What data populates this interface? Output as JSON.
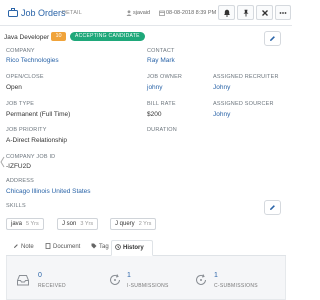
{
  "header": {
    "title": "Job Orders",
    "subtitle": "DETAIL",
    "user": "sjavaid",
    "date": "08-08-2018 8:39 PM",
    "buttons": [
      "bell-icon",
      "pin-icon",
      "close-icon",
      "more-icon"
    ]
  },
  "job": {
    "position_title": "Java Developer",
    "openings_count": "10",
    "status": "ACCEPTING CANDIDATE"
  },
  "details": {
    "company_label": "COMPANY",
    "company": "Rico Technologies",
    "contact_label": "CONTACT",
    "contact": "Ray Mark",
    "open_close_label": "OPEN/CLOSE",
    "open_close": "Open",
    "job_owner_label": "JOB OWNER",
    "job_owner": "johny",
    "assigned_recruiter_label": "ASSIGNED RECRUITER",
    "assigned_recruiter": "Johny",
    "job_type_label": "JOB TYPE",
    "job_type": "Permanent (Full Time)",
    "bill_rate_label": "BILL RATE",
    "bill_rate": "$200",
    "assigned_sourcer_label": "ASSIGNED SOURCER",
    "assigned_sourcer": "Johny",
    "job_priority_label": "JOB PRIORITY",
    "job_priority": "A-Direct Relationship",
    "duration_label": "DURATION",
    "company_job_id_label": "COMPANY JOB ID",
    "company_job_id": "-IZFU2D",
    "address_label": "ADDRESS",
    "address": "Chicago Illinois United States",
    "skills_label": "SKILLS"
  },
  "skills": [
    {
      "name": "java",
      "years": "5 Yrs"
    },
    {
      "name": "J son",
      "years": "3 Yrs"
    },
    {
      "name": "J query",
      "years": "2 Yrs"
    }
  ],
  "tabs": [
    {
      "label": "Note",
      "icon": "note-icon"
    },
    {
      "label": "Document",
      "icon": "document-icon"
    },
    {
      "label": "Tag",
      "icon": "tag-icon"
    },
    {
      "label": "History",
      "icon": "history-icon",
      "active": true
    }
  ],
  "stats": [
    {
      "value": "0",
      "label": "RECEIVED",
      "icon": "inbox-icon"
    },
    {
      "value": "1",
      "label": "I-SUBMISSIONS",
      "icon": "refresh-icon"
    },
    {
      "value": "1",
      "label": "C-SUBMISSIONS",
      "icon": "refresh-icon"
    }
  ],
  "colors": {
    "link": "#2a64a8",
    "badge": "#f0a33a",
    "status": "#1fa87a"
  }
}
